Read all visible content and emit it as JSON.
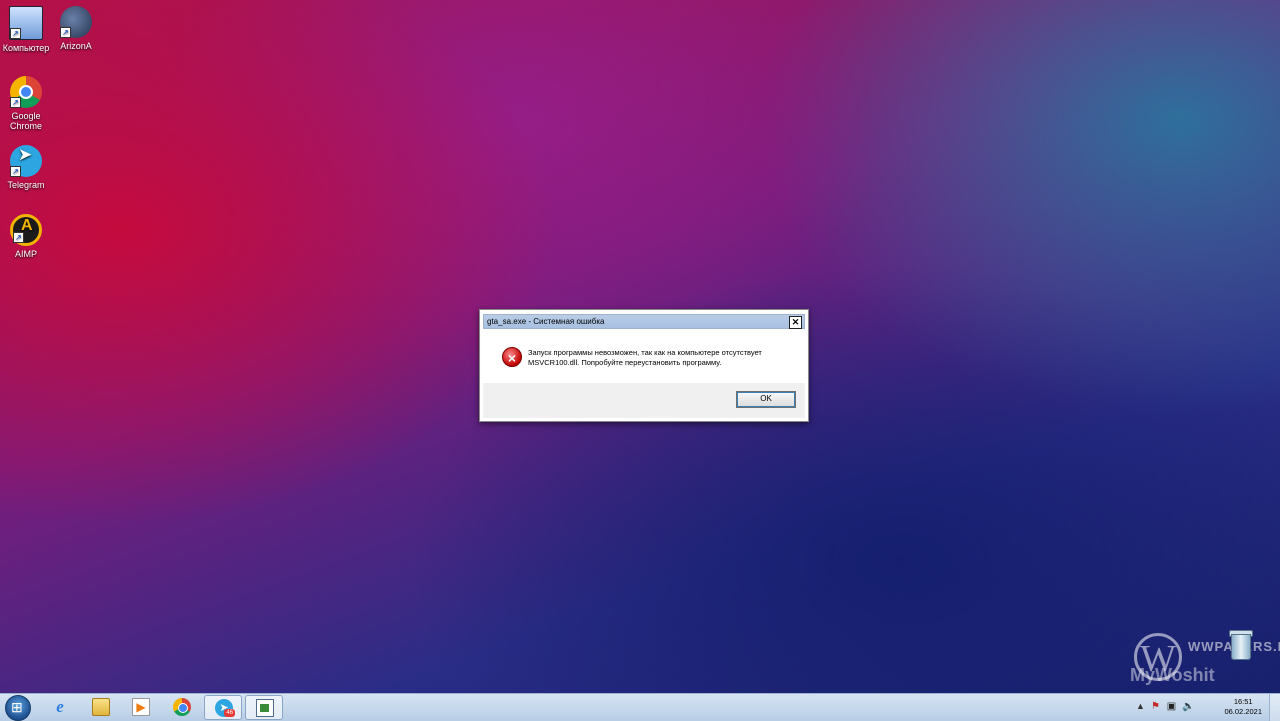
{
  "desktop": {
    "icons": [
      {
        "label": "Компьютер",
        "icon": "computer-icon"
      },
      {
        "label": "ArizonA",
        "icon": "arizona-icon"
      },
      {
        "label": "Google Chrome",
        "icon": "chrome-icon"
      },
      {
        "label": "Telegram",
        "icon": "telegram-icon"
      },
      {
        "label": "AIMP",
        "icon": "aimp-icon"
      }
    ],
    "watermark": {
      "site": "WWPAPERS.RU",
      "letter": "W",
      "sub": "MyWoshit"
    },
    "recycle_bin_icon": "recycle-bin-icon"
  },
  "dialog": {
    "title": "gta_sa.exe - Системная ошибка",
    "close_label": "✕",
    "icon": "error-icon",
    "message": "Запуск программы невозможен, так как на компьютере отсутствует MSVCR100.dll. Попробуйте переустановить программу.",
    "ok_label": "OK"
  },
  "taskbar": {
    "buttons": [
      {
        "icon": "internet-explorer-icon",
        "active": false
      },
      {
        "icon": "file-explorer-icon",
        "active": false
      },
      {
        "icon": "media-player-icon",
        "active": false
      },
      {
        "icon": "chrome-icon",
        "active": false
      },
      {
        "icon": "telegram-icon",
        "active": true,
        "badge": "46"
      },
      {
        "icon": "app-window-icon",
        "active": true
      }
    ],
    "tray": {
      "time": "16:51",
      "date": "06.02.2021"
    }
  }
}
